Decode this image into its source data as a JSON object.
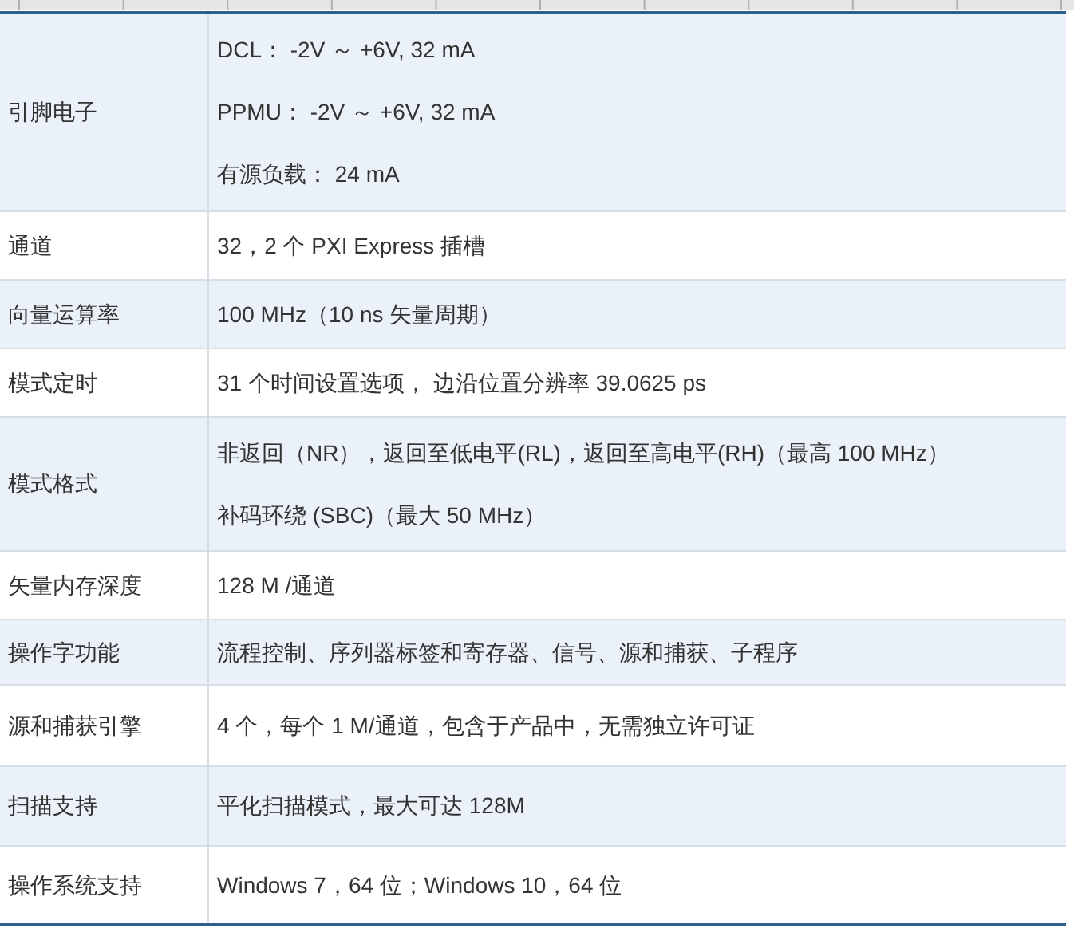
{
  "table": {
    "rows": [
      {
        "label": "引脚电子",
        "shaded": true,
        "values": [
          "DCL： -2V ～ +6V, 32 mA",
          "PPMU： -2V ～ +6V, 32 mA",
          "有源负载： 24 mA"
        ]
      },
      {
        "label": "通道",
        "shaded": false,
        "values": [
          "32，2 个 PXI Express 插槽"
        ]
      },
      {
        "label": "向量运算率",
        "shaded": true,
        "values": [
          "100 MHz（10 ns 矢量周期）"
        ]
      },
      {
        "label": "模式定时",
        "shaded": false,
        "values": [
          "31 个时间设置选项， 边沿位置分辨率 39.0625 ps"
        ]
      },
      {
        "label": "模式格式",
        "shaded": true,
        "values": [
          "非返回（NR），返回至低电平(RL)，返回至高电平(RH)（最高 100 MHz）",
          "补码环绕 (SBC)（最大 50 MHz）"
        ]
      },
      {
        "label": "矢量内存深度",
        "shaded": false,
        "values": [
          "128 M /通道"
        ]
      },
      {
        "label": "操作字功能",
        "shaded": true,
        "values": [
          "流程控制、序列器标签和寄存器、信号、源和捕获、子程序"
        ]
      },
      {
        "label": "源和捕获引擎",
        "shaded": false,
        "values": [
          "4 个，每个 1 M/通道，包含于产品中，无需独立许可证"
        ]
      },
      {
        "label": "扫描支持",
        "shaded": true,
        "values": [
          "平化扫描模式，最大可达 128M"
        ]
      },
      {
        "label": "操作系统支持",
        "shaded": false,
        "values": [
          "Windows 7，64 位；Windows 10，64 位"
        ]
      }
    ]
  }
}
